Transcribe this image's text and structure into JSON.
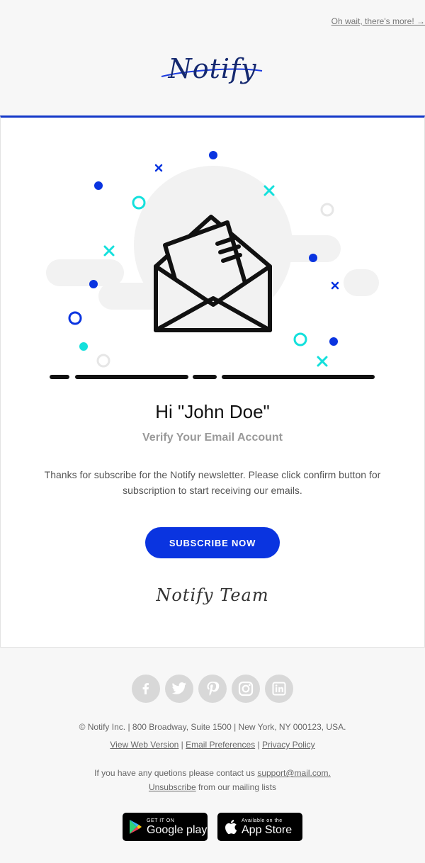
{
  "top_link": "Oh wait, there's more! →",
  "logo": {
    "text": "Notify"
  },
  "card": {
    "greeting": "Hi \"John Doe\"",
    "subtitle": "Verify Your Email Account",
    "body": "Thanks for subscribe for the Notify newsletter. Please click confirm button for subscription to start receiving our emails.",
    "button_label": "SUBSCRIBE NOW",
    "signature": "Notify Team"
  },
  "footer": {
    "social": [
      "facebook-icon",
      "twitter-icon",
      "pinterest-icon",
      "instagram-icon",
      "linkedin-icon"
    ],
    "address": "© Notify Inc. | 800 Broadway, Suite 1500 | New York, NY 000123, USA.",
    "links": {
      "view_web": "View Web Version",
      "email_prefs": "Email Preferences",
      "privacy": "Privacy Policy"
    },
    "contact_prefix": "If you have any quetions please contact us",
    "contact_email": "support@mail.com.",
    "unsubscribe_link": "Unsubscribe",
    "unsubscribe_suffix": " from our mailing lists",
    "google_small": "GET IT ON",
    "google_big": "Google play",
    "apple_small": "Available on the",
    "apple_big": "App Store"
  },
  "colors": {
    "accent": "#0a34e0",
    "teal": "#13e0dc",
    "text": "#555555"
  }
}
